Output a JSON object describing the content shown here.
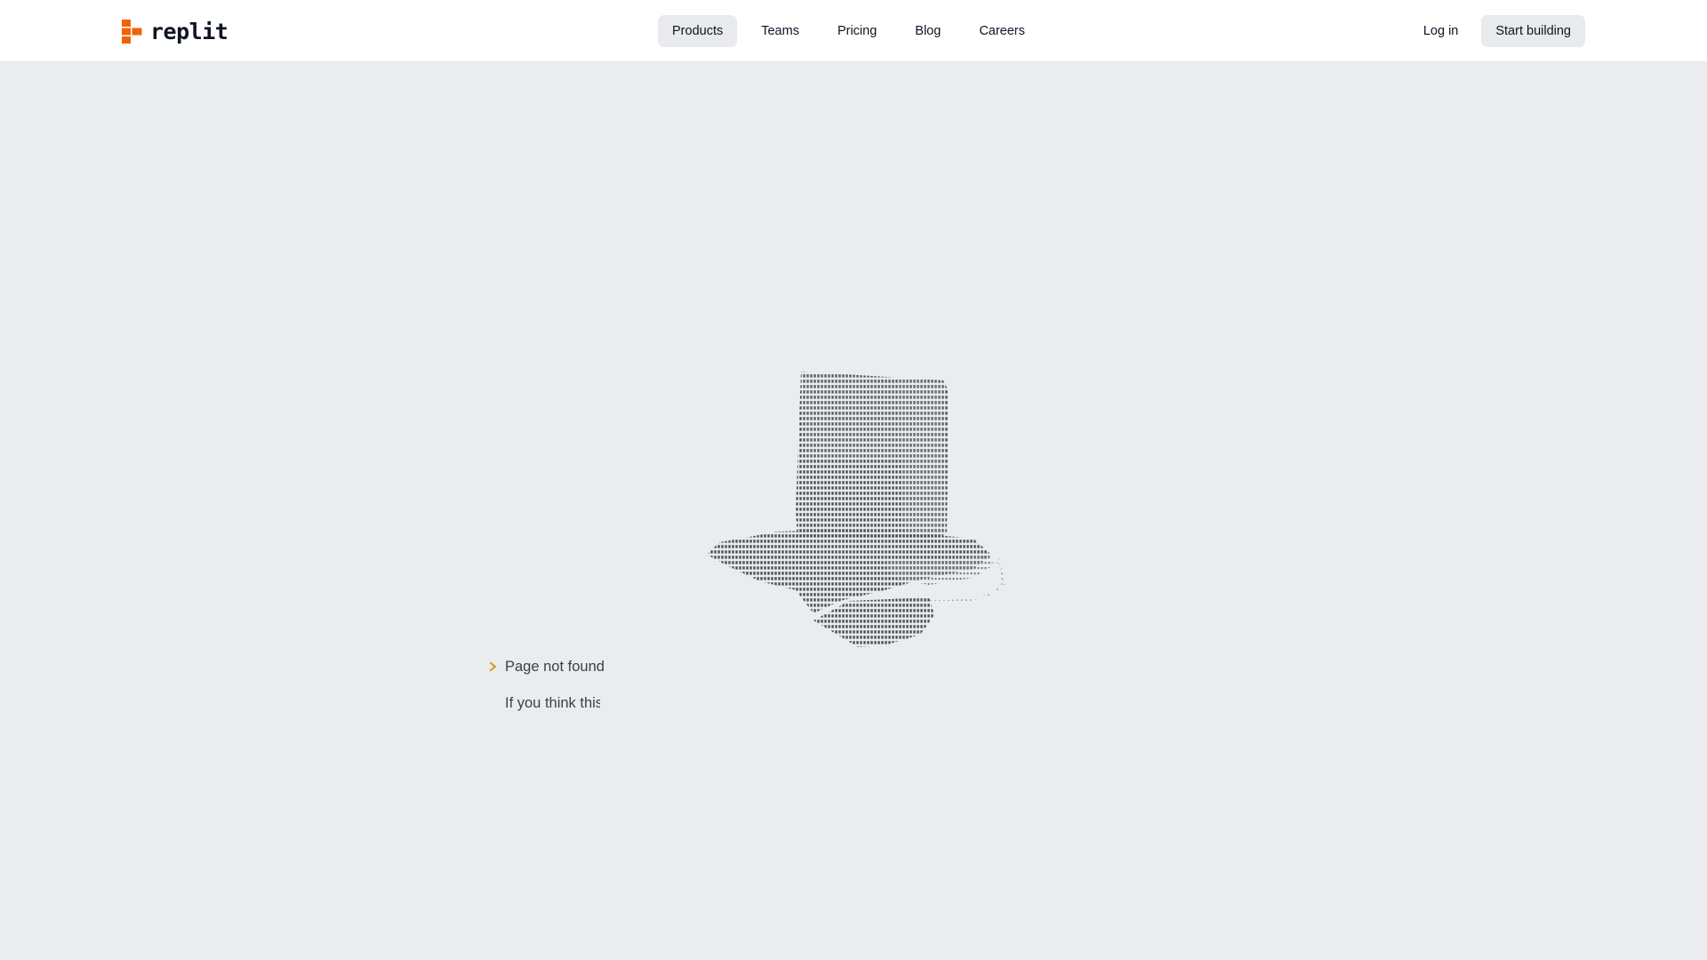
{
  "header": {
    "logo_text": "replit",
    "brand_color": "#f26207",
    "nav_items": [
      {
        "label": "Products",
        "active": true
      },
      {
        "label": "Teams",
        "active": false
      },
      {
        "label": "Pricing",
        "active": false
      },
      {
        "label": "Blog",
        "active": false
      },
      {
        "label": "Careers",
        "active": false
      }
    ],
    "login_label": "Log in",
    "cta_label": "Start building"
  },
  "main": {
    "illustration": "ascii-art-flower-pot-on-cloud",
    "title": "Page not found",
    "description": "If you think this"
  },
  "colors": {
    "page_background": "#ebecee",
    "header_background": "#ffffff",
    "text": "#0e1525",
    "accent": "#f26207",
    "chevron": "#d29a1f"
  }
}
